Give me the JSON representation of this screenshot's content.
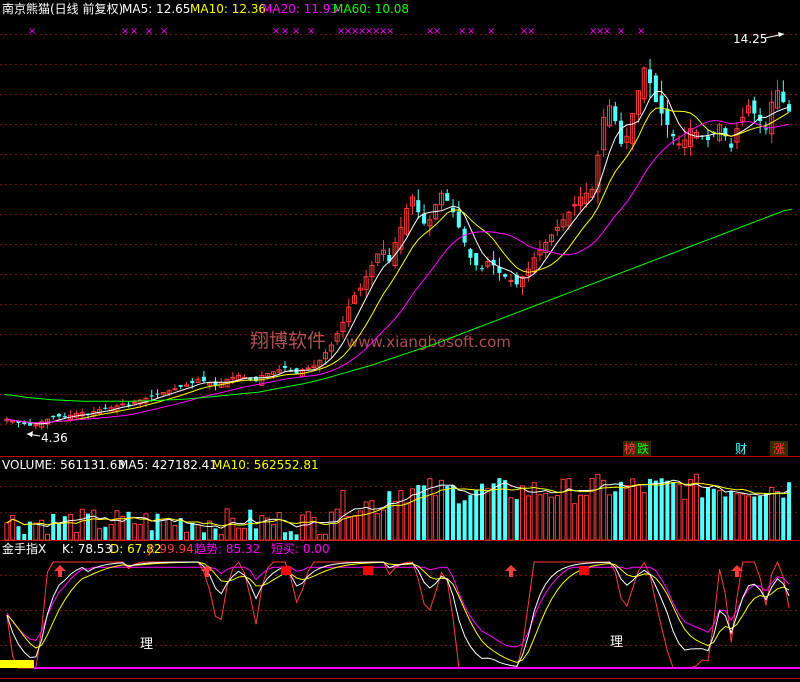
{
  "colors": {
    "up": "#ff3c3c",
    "down": "#54ffff",
    "ma5": "#ffffff",
    "ma10": "#ffff00",
    "ma20": "#ff00ff",
    "ma60": "#00ff00",
    "grid": "#7a1010",
    "panel_border": "#c00000",
    "magenta_mark": "#ff00ff",
    "watermark": "#d07070"
  },
  "price_panel": {
    "title": "南京熊猫(日线 前复权)",
    "ma5_label": "MA5: 12.65",
    "ma10_label": "MA10: 12.36",
    "ma20_label": "MA20: 11.93",
    "ma60_label": "MA60: 10.08",
    "high_label": "14.25",
    "low_label": "4.36",
    "watermark_cn": "翔博软件",
    "watermark_url": "www.xiangbosoft.com",
    "tags": [
      {
        "text": "榜",
        "color": "#ff3c3c",
        "bg": "#3a2a00"
      },
      {
        "text": "跌",
        "color": "#00ff00",
        "bg": "#3a2a00"
      },
      {
        "text": "财",
        "color": "#54ffff",
        "bg": "#000"
      },
      {
        "text": "涨",
        "color": "#ff3c3c",
        "bg": "#3a2a00"
      }
    ],
    "x_marks": "×"
  },
  "volume_panel": {
    "volume_label": "VOLUME: 561131.63",
    "ma5_label": "MA5: 427182.41",
    "ma10_label": "MA10: 562552.81"
  },
  "indicator_panel": {
    "name": "金手指X",
    "k_label": "K: 78.53",
    "d_label": "D: 67.82",
    "j_label": "J: 99.94",
    "trend_label": "趋势: 85.32",
    "short_buy_label": "短买: 0.00",
    "zone_text_1": "理",
    "zone_text_2": "理"
  },
  "chart_data": {
    "type": "candlestick",
    "title": "南京熊猫(日线 前复权)",
    "y_range_price": [
      4.0,
      14.8
    ],
    "price_high": 14.25,
    "price_low": 4.36,
    "ma_latest": {
      "MA5": 12.65,
      "MA10": 12.36,
      "MA20": 11.93,
      "MA60": 10.08
    },
    "close_series": [
      4.55,
      4.5,
      4.45,
      4.42,
      4.38,
      4.4,
      4.48,
      4.55,
      4.6,
      4.62,
      4.6,
      4.65,
      4.7,
      4.72,
      4.68,
      4.75,
      4.8,
      4.82,
      4.85,
      4.9,
      4.95,
      4.92,
      5.0,
      5.05,
      5.1,
      5.15,
      5.2,
      5.25,
      5.3,
      5.35,
      5.4,
      5.45,
      5.5,
      5.6,
      5.55,
      5.5,
      5.45,
      5.5,
      5.6,
      5.65,
      5.7,
      5.65,
      5.6,
      5.55,
      5.7,
      5.75,
      5.8,
      5.85,
      5.9,
      5.8,
      5.75,
      5.85,
      5.9,
      5.95,
      6.1,
      6.3,
      6.5,
      6.8,
      7.1,
      7.5,
      7.8,
      8.0,
      8.3,
      8.6,
      8.9,
      9.0,
      8.7,
      9.2,
      9.6,
      10.1,
      10.4,
      10.0,
      9.7,
      9.8,
      10.2,
      10.5,
      10.3,
      10.0,
      9.6,
      9.2,
      8.8,
      8.6,
      8.5,
      8.7,
      8.6,
      8.4,
      8.3,
      8.2,
      8.1,
      8.3,
      8.5,
      8.8,
      9.0,
      9.2,
      9.4,
      9.6,
      9.8,
      10.0,
      10.2,
      10.4,
      10.5,
      10.6,
      11.5,
      12.5,
      12.8,
      12.4,
      11.8,
      12.0,
      12.6,
      13.2,
      13.8,
      13.4,
      12.9,
      12.6,
      12.3,
      12.0,
      11.8,
      11.9,
      12.2,
      12.1,
      12.0,
      11.9,
      12.1,
      12.3,
      12.0,
      11.7,
      12.2,
      12.5,
      12.8,
      12.6,
      12.4,
      12.2,
      12.9,
      13.2,
      12.9,
      12.65
    ],
    "ma60_series": [
      5.2,
      5.18,
      5.15,
      5.12,
      5.1,
      5.08,
      5.06,
      5.05,
      5.04,
      5.03,
      5.02,
      5.02,
      5.02,
      5.02,
      5.02,
      5.02,
      5.02,
      5.03,
      5.03,
      5.04,
      5.05,
      5.06,
      5.07,
      5.08,
      5.1,
      5.12,
      5.14,
      5.16,
      5.18,
      5.2,
      5.22,
      5.24,
      5.26,
      5.3,
      5.34,
      5.38,
      5.42,
      5.46,
      5.5,
      5.55,
      5.6,
      5.66,
      5.72,
      5.78,
      5.84,
      5.9,
      5.96,
      6.03,
      6.1,
      6.17,
      6.24,
      6.31,
      6.38,
      6.45,
      6.52,
      6.6,
      6.68,
      6.76,
      6.84,
      6.92,
      7.0,
      7.08,
      7.16,
      7.24,
      7.32,
      7.4,
      7.48,
      7.56,
      7.64,
      7.72,
      7.8,
      7.88,
      7.96,
      8.04,
      8.12,
      8.2,
      8.28,
      8.36,
      8.44,
      8.52,
      8.6,
      8.68,
      8.76,
      8.84,
      8.92,
      9.0,
      9.08,
      9.16,
      9.24,
      9.32,
      9.4,
      9.48,
      9.56,
      9.64,
      9.72,
      9.8,
      9.88,
      9.96,
      10.04,
      10.08
    ],
    "volume_latest": 561131.63,
    "volume_ma5": 427182.41,
    "volume_ma10": 562552.81,
    "kdj_latest": {
      "K": 78.53,
      "D": 67.82,
      "J": 99.94,
      "趋势": 85.32,
      "短买": 0.0
    }
  }
}
